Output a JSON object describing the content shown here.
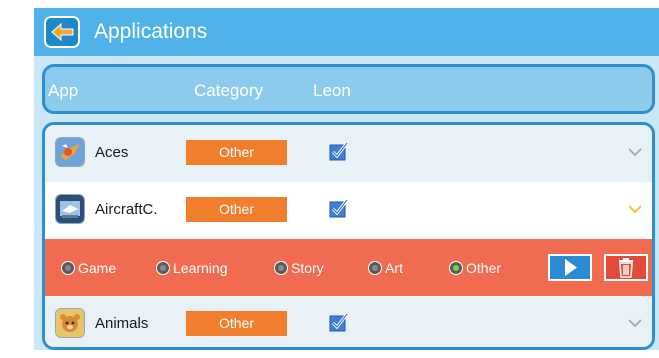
{
  "window": {
    "title": "Applications"
  },
  "header": {
    "app": "App",
    "category": "Category",
    "user": "Leon"
  },
  "apps": [
    {
      "name": "Aces",
      "category": "Other",
      "checked": true,
      "icon": "aces-app-icon"
    },
    {
      "name": "AircraftC.",
      "category": "Other",
      "checked": true,
      "icon": "aircraftc-app-icon",
      "expanded": true
    },
    {
      "name": "Animals",
      "category": "Other",
      "checked": true,
      "icon": "animals-app-icon"
    }
  ],
  "category_panel": {
    "options": [
      "Game",
      "Learning",
      "Story",
      "Art",
      "Other"
    ],
    "selected": "Other"
  },
  "icons": {
    "back": "back-arrow-icon",
    "play": "play-icon",
    "delete": "trash-icon",
    "expand": "chevron-down-icon",
    "check": "checkbox-icon"
  },
  "colors": {
    "topbar": "#4fb3e9",
    "accent_orange": "#f07e2d",
    "panel_red": "#f06b50",
    "chevron_active": "#f2c21b",
    "border_blue": "#2d8fd0"
  }
}
